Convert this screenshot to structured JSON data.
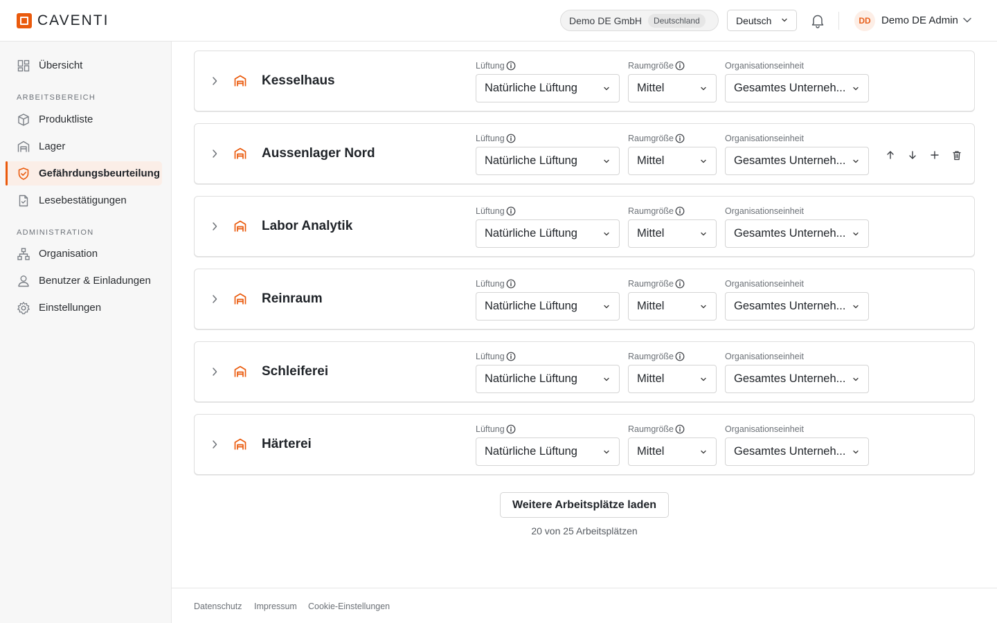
{
  "app": {
    "brand": "CAVENTI"
  },
  "header": {
    "org_name": "Demo DE GmbH",
    "org_country": "Deutschland",
    "language": "Deutsch",
    "avatar_initials": "DD",
    "user_name": "Demo DE Admin"
  },
  "sidebar": {
    "overview": "Übersicht",
    "section_workspace": "ARBEITSBEREICH",
    "items_workspace": [
      {
        "label": "Produktliste",
        "icon": "cube-icon"
      },
      {
        "label": "Lager",
        "icon": "warehouse-icon"
      },
      {
        "label": "Gefährdungsbeurteilung",
        "icon": "shield-icon",
        "active": true
      },
      {
        "label": "Lesebestätigungen",
        "icon": "document-check-icon"
      }
    ],
    "section_admin": "ADMINISTRATION",
    "items_admin": [
      {
        "label": "Organisation",
        "icon": "org-chart-icon"
      },
      {
        "label": "Benutzer & Einladungen",
        "icon": "user-icon"
      },
      {
        "label": "Einstellungen",
        "icon": "gear-icon"
      }
    ]
  },
  "labels": {
    "ventilation": "Lüftung",
    "room_size": "Raumgröße",
    "org_unit": "Organisationseinheit"
  },
  "workplaces": [
    {
      "name": "Kesselhaus",
      "ventilation": "Natürliche Lüftung",
      "room_size": "Mittel",
      "org_unit": "Gesamtes Unterneh..."
    },
    {
      "name": "Aussenlager Nord",
      "ventilation": "Natürliche Lüftung",
      "room_size": "Mittel",
      "org_unit": "Gesamtes Unterneh..."
    },
    {
      "name": "Labor Analytik",
      "ventilation": "Natürliche Lüftung",
      "room_size": "Mittel",
      "org_unit": "Gesamtes Unterneh..."
    },
    {
      "name": "Reinraum",
      "ventilation": "Natürliche Lüftung",
      "room_size": "Mittel",
      "org_unit": "Gesamtes Unterneh..."
    },
    {
      "name": "Schleiferei",
      "ventilation": "Natürliche Lüftung",
      "room_size": "Mittel",
      "org_unit": "Gesamtes Unterneh..."
    },
    {
      "name": "Härterei",
      "ventilation": "Natürliche Lüftung",
      "room_size": "Mittel",
      "org_unit": "Gesamtes Unterneh..."
    }
  ],
  "pagination": {
    "load_more": "Weitere Arbeitsplätze laden",
    "count_text": "20 von 25 Arbeitsplätzen"
  },
  "footer": {
    "privacy": "Datenschutz",
    "imprint": "Impressum",
    "cookies": "Cookie-Einstellungen"
  },
  "colors": {
    "accent": "#ea5a0c",
    "active_bg": "#fbeee7"
  }
}
